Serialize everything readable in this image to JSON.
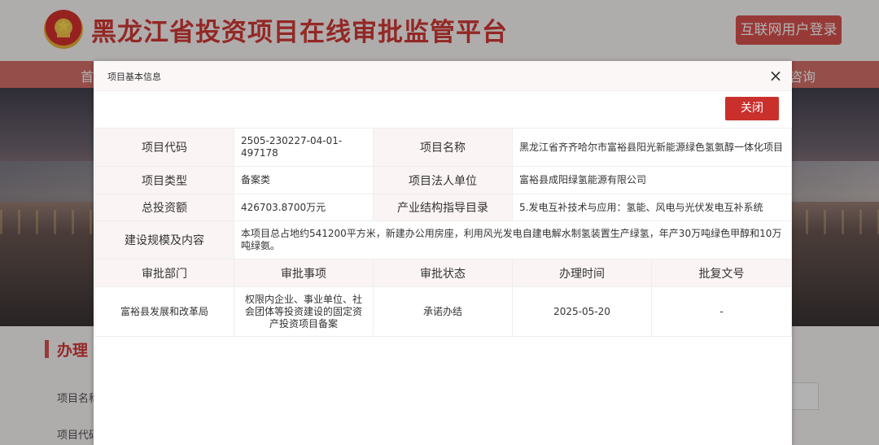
{
  "site": {
    "title": "黑龙江省投资项目在线审批监管平台",
    "login_label": "互联网用户登录",
    "nav_first": "首",
    "nav_last": "咨询"
  },
  "page": {
    "section_title": "办理",
    "form_labels": [
      "项目名称",
      "项目代码"
    ]
  },
  "modal": {
    "title": "项目基本信息",
    "close_icon": "×",
    "close_button": "关闭",
    "labels": {
      "code": "项目代码",
      "name": "项目名称",
      "type": "项目类型",
      "legal": "项目法人单位",
      "total": "总投资额",
      "industry": "产业结构指导目录",
      "scale": "建设规模及内容"
    },
    "values": {
      "code": "2505-230227-04-01-497178",
      "name": "黑龙江省齐齐哈尔市富裕县阳光新能源绿色氢氨醇一体化项目",
      "type": "备案类",
      "legal": "富裕县成阳绿氢能源有限公司",
      "total": "426703.8700万元",
      "industry": "5.发电互补技术与应用：氢能、风电与光伏发电互补系统",
      "scale": "本项目总占地约541200平方米，新建办公用房座，利用风光发电自建电解水制氢装置生产绿氢，年产30万吨绿色甲醇和10万吨绿氨。"
    },
    "approval_headers": [
      "审批部门",
      "审批事项",
      "审批状态",
      "办理时间",
      "批复文号"
    ],
    "approval_rows": [
      [
        "富裕县发展和改革局",
        "权限内企业、事业单位、社会团体等投资建设的固定资产投资项目备案",
        "承诺办结",
        "2025-05-20",
        "-"
      ]
    ]
  },
  "colors": {
    "brand_red": "#d33a36",
    "button_red": "#c9302c",
    "label_bg": "#fbf4f4"
  }
}
